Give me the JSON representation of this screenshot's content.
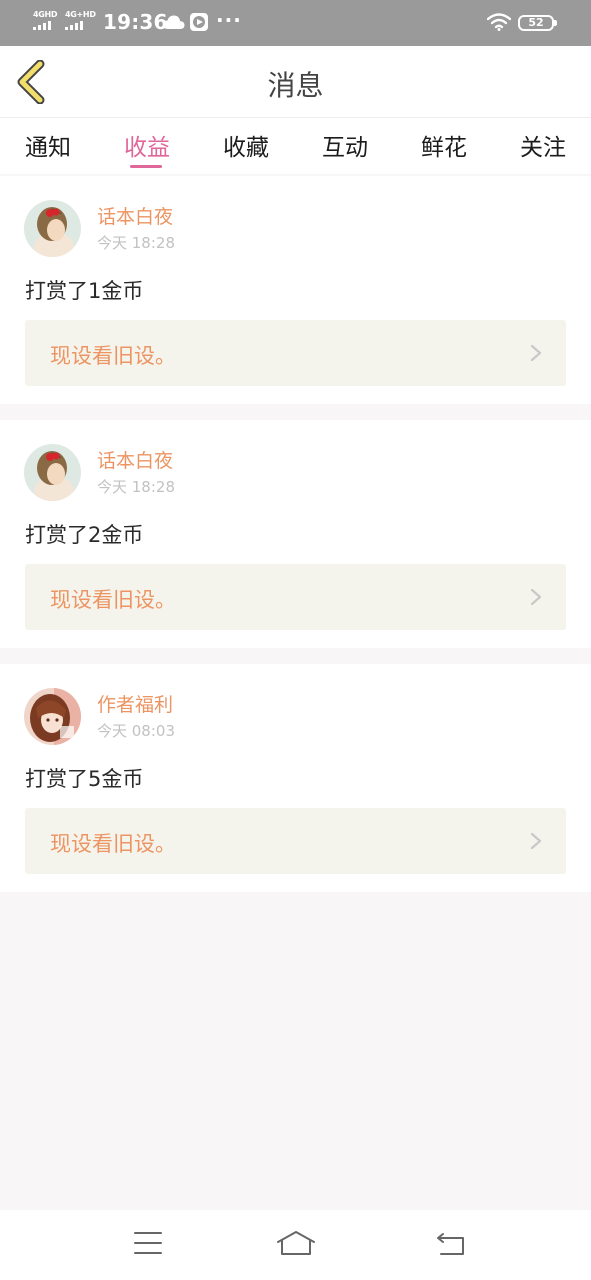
{
  "status_bar": {
    "sim1": "4GHD",
    "sim2": "4G+HD",
    "time": "19:36",
    "more": "···",
    "battery": "52"
  },
  "header": {
    "title": "消息"
  },
  "tabs": [
    {
      "label": "通知"
    },
    {
      "label": "收益",
      "active": true
    },
    {
      "label": "收藏"
    },
    {
      "label": "互动"
    },
    {
      "label": "鲜花"
    },
    {
      "label": "关注"
    }
  ],
  "messages": [
    {
      "name": "话本白夜",
      "time": "今天 18:28",
      "text": "打赏了1金币",
      "ref": "现设看旧设。"
    },
    {
      "name": "话本白夜",
      "time": "今天 18:28",
      "text": "打赏了2金币",
      "ref": "现设看旧设。"
    },
    {
      "name": "作者福利",
      "time": "今天 08:03",
      "text": "打赏了5金币",
      "ref": "现设看旧设。"
    }
  ],
  "colors": {
    "accent": "#e0679a",
    "name": "#ec9563",
    "status_bar": "#9a9a9a",
    "back_arrow": "#f2de6a"
  },
  "icons": {
    "back": "chevron-left-icon",
    "ref_arrow": "chevron-right-icon",
    "nav_menu": "menu-icon",
    "nav_home": "home-icon",
    "nav_back": "back-icon"
  }
}
